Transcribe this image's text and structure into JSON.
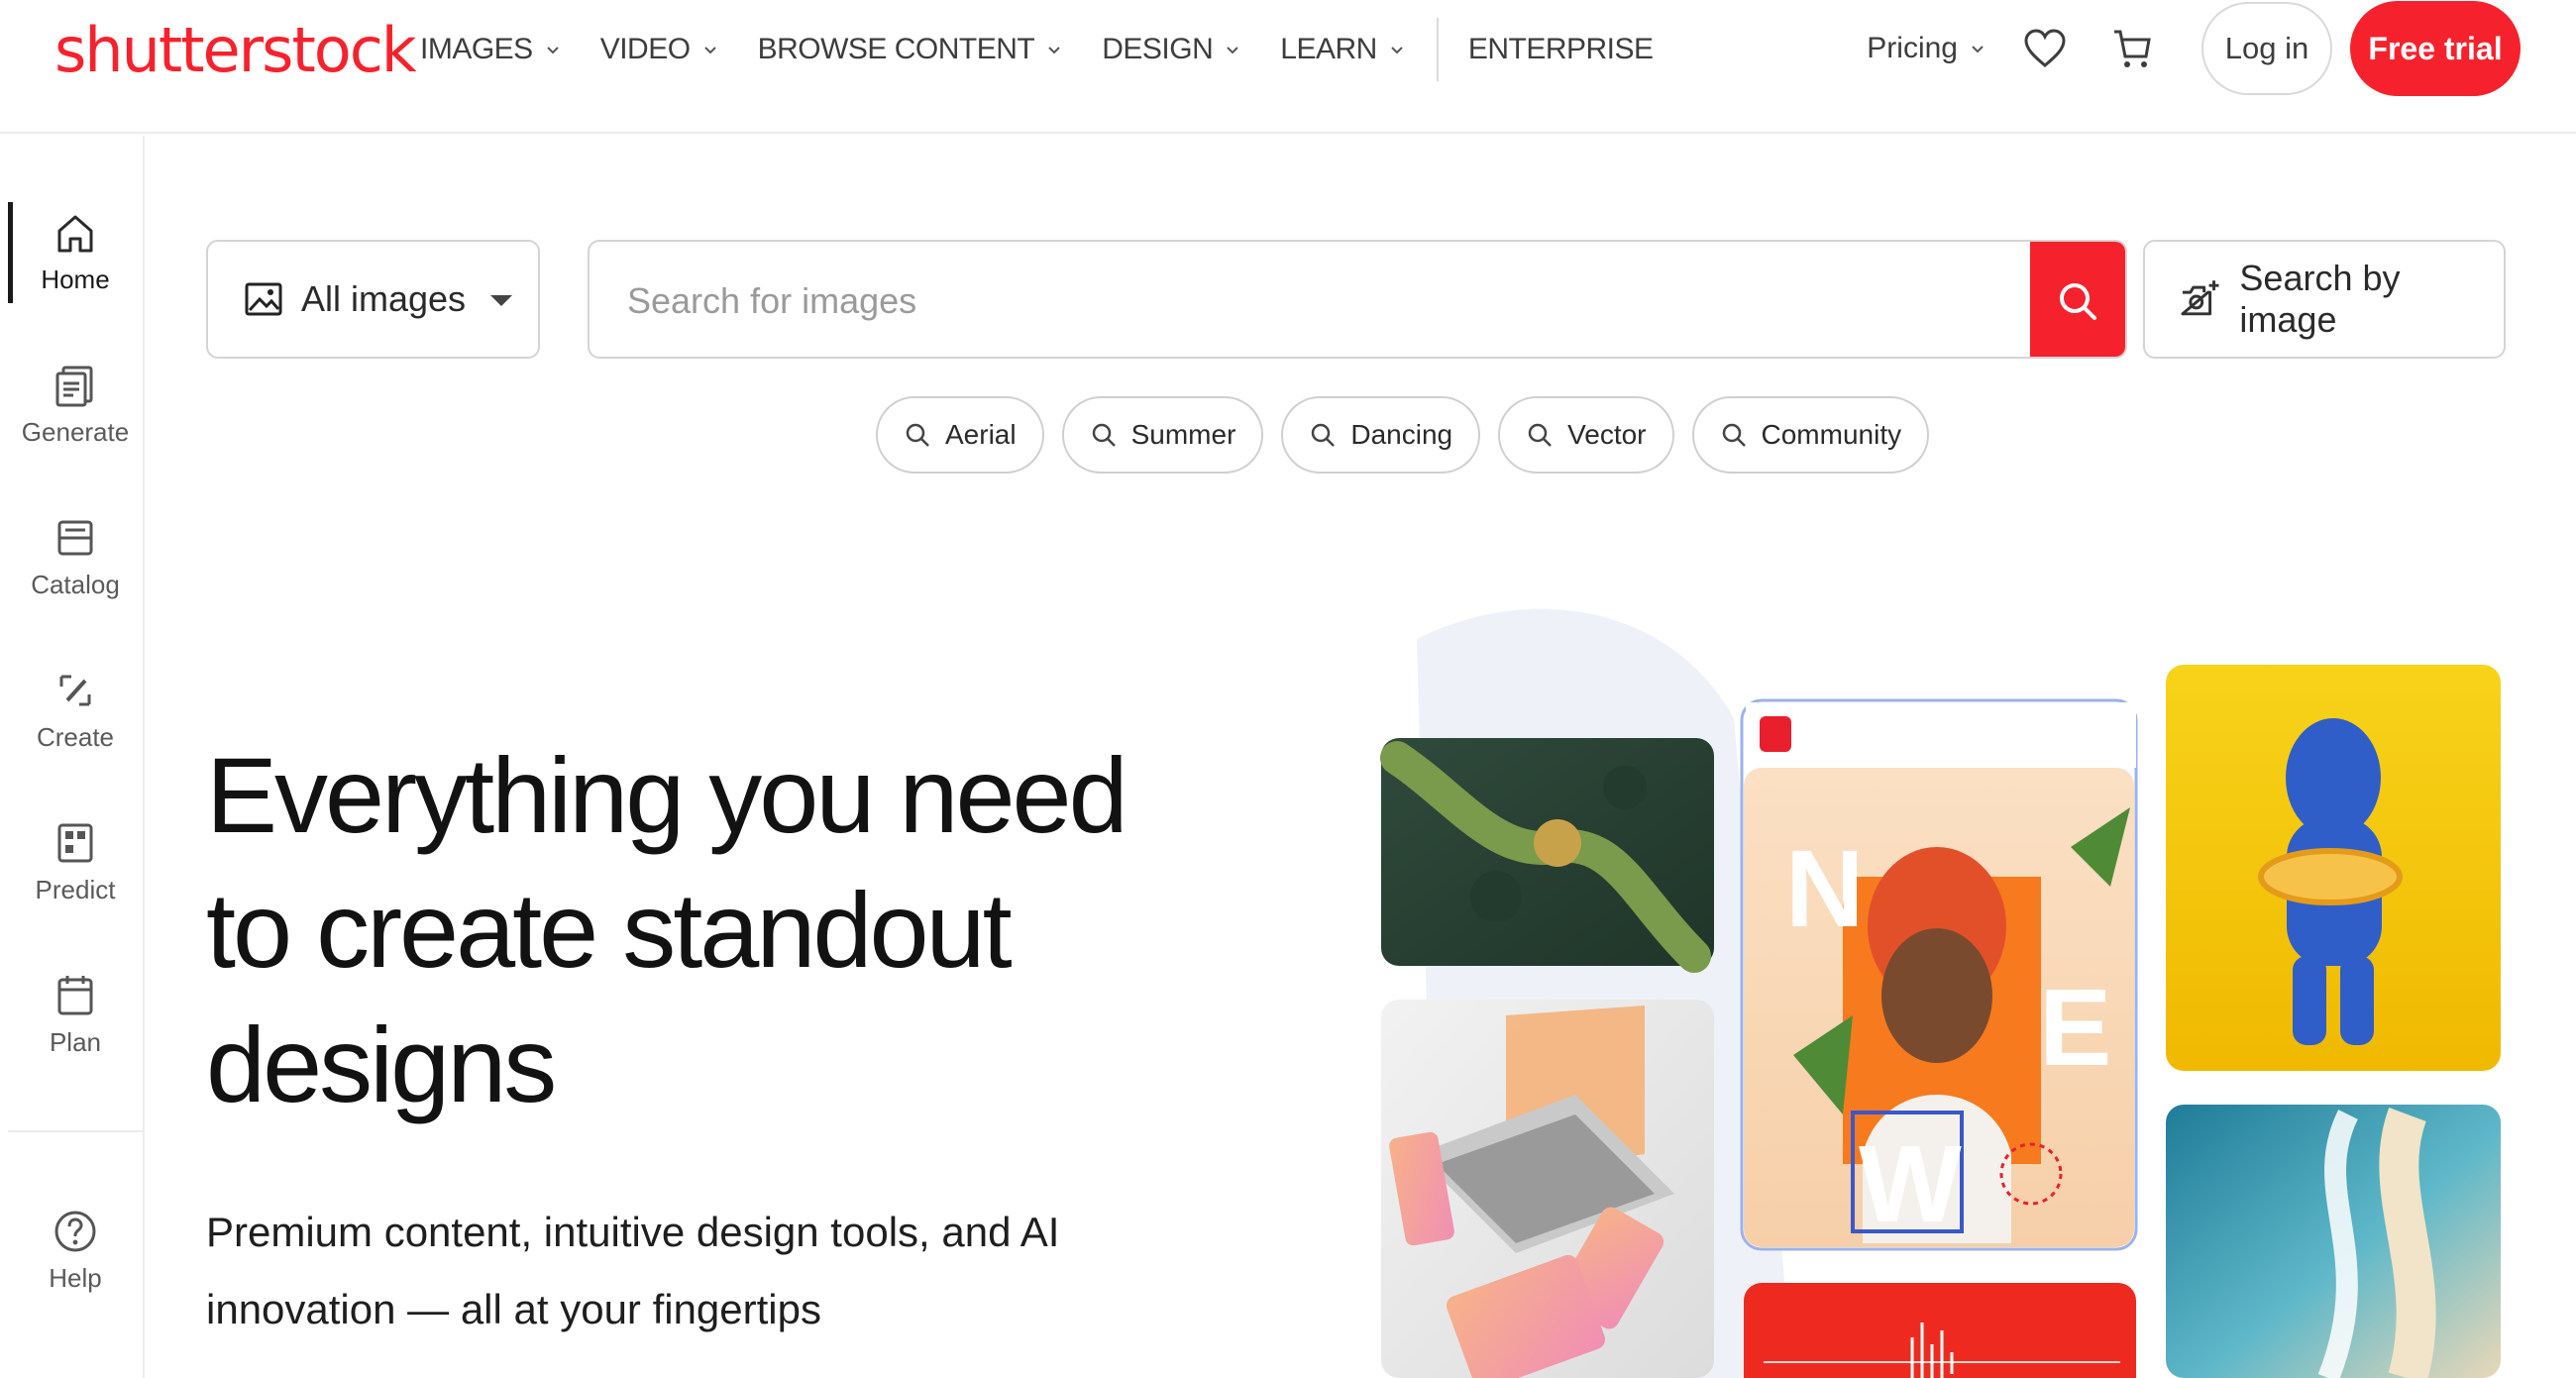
{
  "header": {
    "logo_text": "shutterstock",
    "nav": [
      {
        "label": "IMAGES"
      },
      {
        "label": "VIDEO"
      },
      {
        "label": "BROWSE CONTENT"
      },
      {
        "label": "DESIGN"
      },
      {
        "label": "LEARN"
      }
    ],
    "enterprise": "ENTERPRISE",
    "pricing": "Pricing",
    "login": "Log in",
    "free_trial": "Free trial",
    "icons": [
      "heart-icon",
      "cart-icon"
    ]
  },
  "sidebar": {
    "items": [
      {
        "label": "Home",
        "icon": "home-icon",
        "active": true
      },
      {
        "label": "Generate",
        "icon": "generate-icon"
      },
      {
        "label": "Catalog",
        "icon": "catalog-icon"
      },
      {
        "label": "Create",
        "icon": "create-icon"
      },
      {
        "label": "Predict",
        "icon": "predict-icon"
      },
      {
        "label": "Plan",
        "icon": "plan-icon"
      }
    ],
    "help": {
      "label": "Help",
      "icon": "help-icon"
    }
  },
  "search": {
    "type_label": "All images",
    "placeholder": "Search for images",
    "value": "",
    "by_image": "Search by image",
    "chips": [
      {
        "label": "Aerial"
      },
      {
        "label": "Summer"
      },
      {
        "label": "Dancing"
      },
      {
        "label": "Vector"
      },
      {
        "label": "Community"
      }
    ]
  },
  "hero": {
    "headline_lines": [
      "Everything you need",
      "to create standout",
      "designs"
    ],
    "subtext_lines": [
      "Premium content, intuitive design tools, and AI",
      "innovation — all at your fingertips"
    ],
    "collage_letters": [
      "N",
      "E",
      "W"
    ]
  },
  "colors": {
    "brand": "#f5222d",
    "text": "#1a1a1a",
    "border": "#d4d4d4"
  }
}
